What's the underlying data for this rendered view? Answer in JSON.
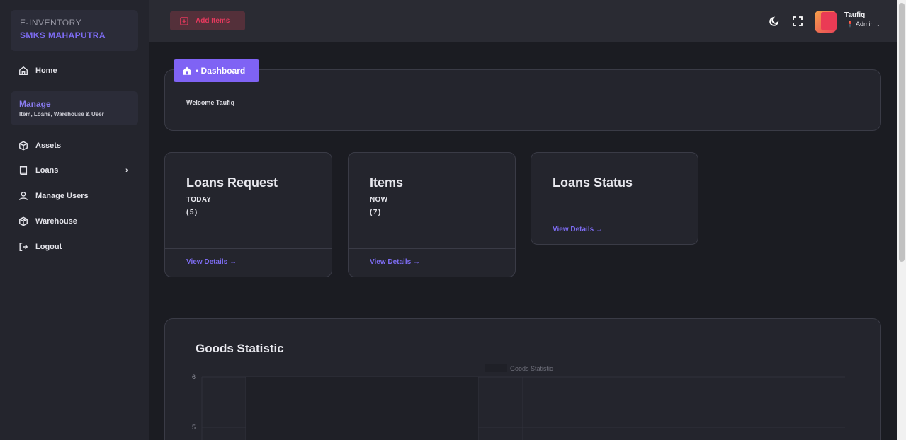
{
  "sidebar": {
    "brand_line1": "E-INVENTORY",
    "brand_line2": "SMKS MAHAPUTRA",
    "home_label": "Home",
    "manage_title": "Manage",
    "manage_subtitle": "Item, Loans, Warehouse & User",
    "items": [
      {
        "label": "Assets",
        "icon": "cube-icon"
      },
      {
        "label": "Loans",
        "icon": "book-icon",
        "has_submenu": true
      },
      {
        "label": "Manage Users",
        "icon": "user-icon"
      },
      {
        "label": "Warehouse",
        "icon": "warehouse-icon"
      },
      {
        "label": "Logout",
        "icon": "logout-icon"
      }
    ]
  },
  "topbar": {
    "add_button_label": "Add Items",
    "user_name": "Taufiq",
    "user_role": "Admin"
  },
  "breadcrumb": {
    "label": "• Dashboard"
  },
  "welcome": {
    "text": "Welcome Taufiq"
  },
  "cards": [
    {
      "title": "Loans Request",
      "subtitle": "TODAY",
      "count": "(5)",
      "link": "View Details →"
    },
    {
      "title": "Items",
      "subtitle": "NOW",
      "count": "(7)",
      "link": "View Details →"
    },
    {
      "title": "Loans Status",
      "subtitle": "",
      "count": "",
      "link": "View Details →"
    }
  ],
  "chart": {
    "card_title": "Goods Statistic",
    "legend_label": "Goods Statistic"
  },
  "chart_data": {
    "type": "bar",
    "title": "Goods Statistic",
    "series": [
      {
        "name": "Goods Statistic"
      }
    ],
    "y_ticks": [
      6,
      5
    ],
    "ylim": [
      4.9,
      6
    ],
    "legend": "top-center",
    "grid": true
  },
  "colors": {
    "accent": "#7f63f4",
    "link": "#7d6cf2",
    "danger": "#e5395d",
    "background": "#1b1c22",
    "surface": "#24252d"
  }
}
